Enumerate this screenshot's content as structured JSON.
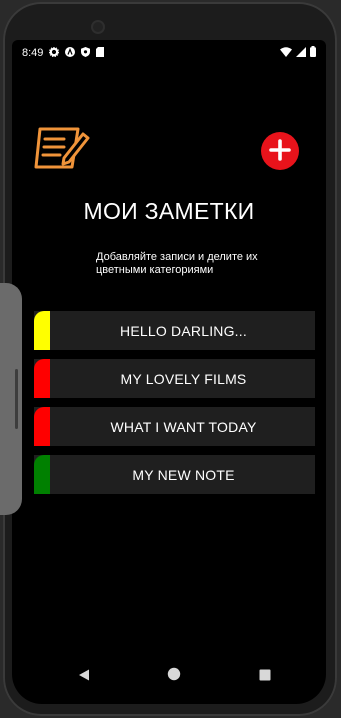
{
  "status_bar": {
    "time": "8:49",
    "left_icons": [
      "gear-icon",
      "a-circle-icon",
      "shield-icon",
      "sd-card-icon"
    ],
    "right_icons": [
      "wifi-icon",
      "signal-icon",
      "battery-icon"
    ]
  },
  "header": {
    "logo_icon": "notepad-pen-icon",
    "add_icon": "plus-icon",
    "add_color": "#e8131b",
    "title": "МОИ ЗАМЕТКИ",
    "subtitle": "Добавляйте записи и делите их цветными категориями"
  },
  "notes": [
    {
      "label": "HELLO DARLING...",
      "color": "#ffff00"
    },
    {
      "label": "MY LOVELY FILMS",
      "color": "#ff0000"
    },
    {
      "label": "WHAT I WANT TODAY",
      "color": "#ff0000"
    },
    {
      "label": "MY NEW NOTE",
      "color": "#008000"
    }
  ],
  "nav_bar": {
    "icons": [
      "back-triangle-icon",
      "home-circle-icon",
      "recents-square-icon"
    ]
  }
}
